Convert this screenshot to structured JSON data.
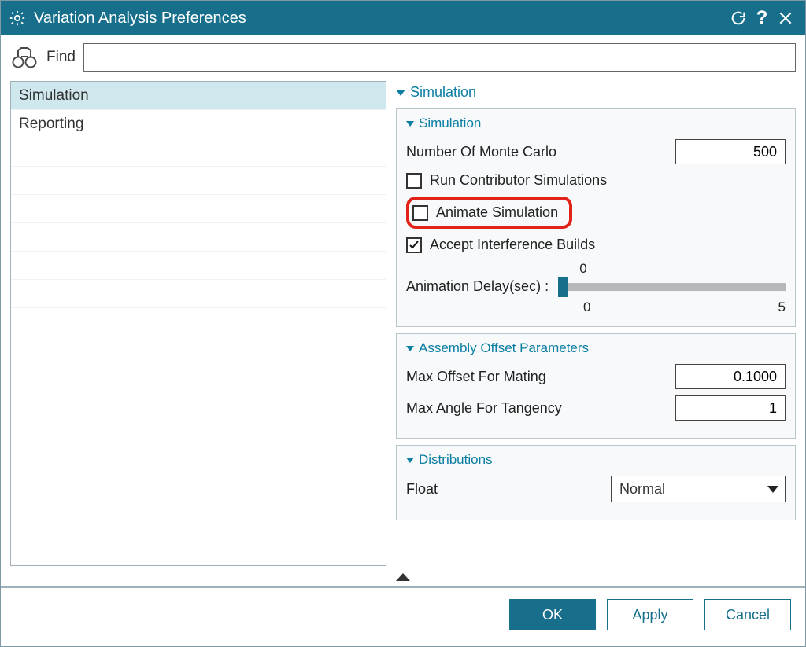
{
  "title": "Variation Analysis Preferences",
  "find": {
    "label": "Find",
    "value": ""
  },
  "nav": {
    "items": [
      "Simulation",
      "Reporting"
    ],
    "selected_index": 0
  },
  "right": {
    "outer_title": "Simulation",
    "sim_group": {
      "title": "Simulation",
      "monte_carlo": {
        "label": "Number Of Monte Carlo",
        "value": "500"
      },
      "run_contributor": {
        "label": "Run Contributor Simulations",
        "checked": false
      },
      "animate": {
        "label": "Animate Simulation",
        "checked": false
      },
      "accept_interf": {
        "label": "Accept Interference Builds",
        "checked": true
      },
      "anim_delay": {
        "label": "Animation Delay(sec) :",
        "value": "0",
        "min": "0",
        "max": "5"
      }
    },
    "offset_group": {
      "title": "Assembly Offset Parameters",
      "max_offset": {
        "label": "Max Offset For Mating",
        "value": "0.1000"
      },
      "max_tangency": {
        "label": "Max Angle For Tangency",
        "value": "1"
      }
    },
    "dist_group": {
      "title": "Distributions",
      "float": {
        "label": "Float",
        "value": "Normal"
      }
    }
  },
  "footer": {
    "ok": "OK",
    "apply": "Apply",
    "cancel": "Cancel"
  }
}
